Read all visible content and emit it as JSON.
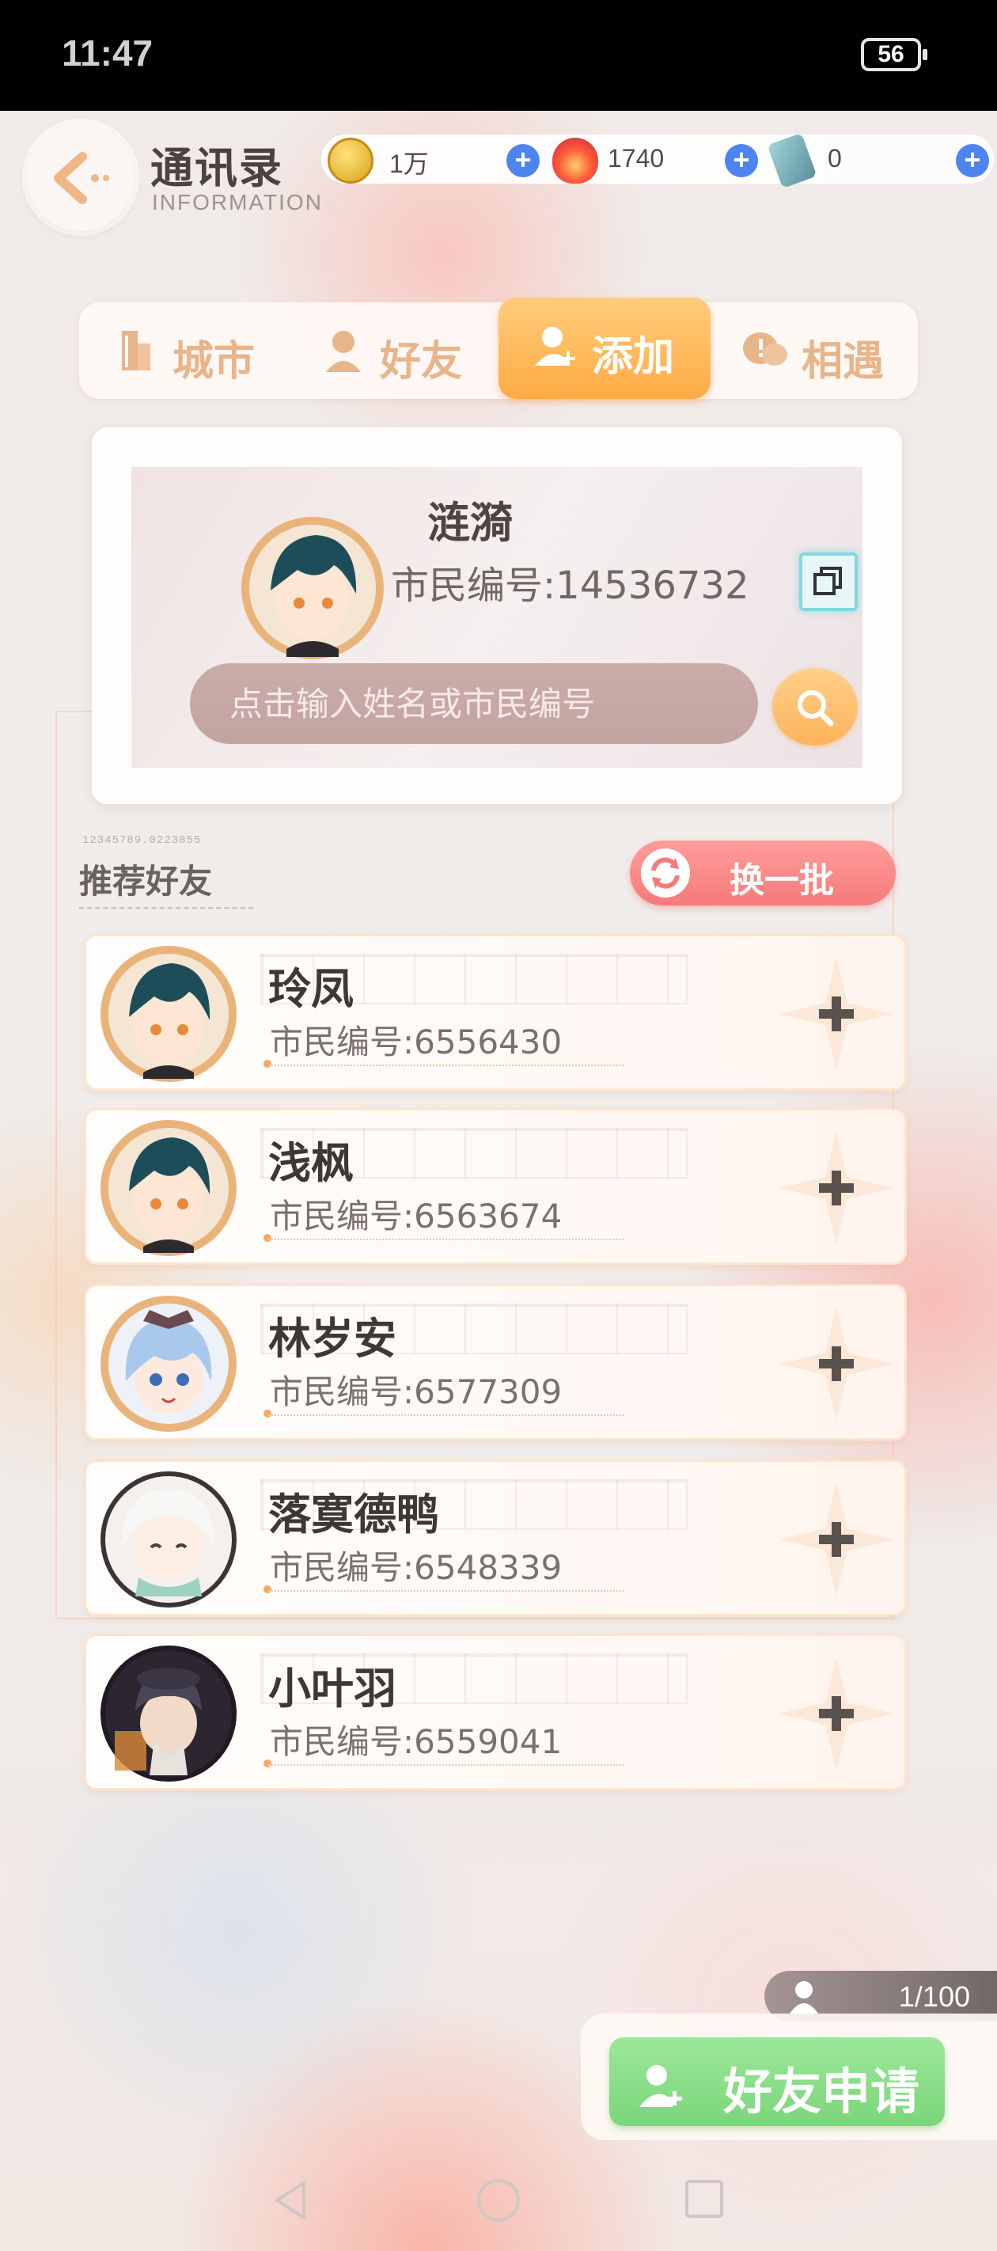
{
  "status_bar": {
    "time": "11:47",
    "battery": "56"
  },
  "header": {
    "title": "通讯录",
    "subtitle": "INFORMATION",
    "currencies": [
      {
        "icon": "gold-coin-icon",
        "value": "1万"
      },
      {
        "icon": "red-crystal-icon",
        "value": "1740"
      },
      {
        "icon": "blue-ticket-icon",
        "value": "0"
      }
    ]
  },
  "tabs": [
    {
      "label": "城市",
      "icon": "city-icon",
      "active": false
    },
    {
      "label": "好友",
      "icon": "friend-icon",
      "active": false
    },
    {
      "label": "添加",
      "icon": "add-friend-icon",
      "active": true
    },
    {
      "label": "相遇",
      "icon": "encounter-icon",
      "active": false
    }
  ],
  "me": {
    "name": "涟漪",
    "id_label": "市民编号:14536732"
  },
  "search": {
    "placeholder": "点击输入姓名或市民编号"
  },
  "recommend": {
    "code": "12345789.0223855",
    "title": "推荐好友",
    "refresh_label": "换一批",
    "friends": [
      {
        "name": "玲凤",
        "id_label": "市民编号:6556430",
        "avatar": "avatar-teal-boy"
      },
      {
        "name": "浅枫",
        "id_label": "市民编号:6563674",
        "avatar": "avatar-teal-boy"
      },
      {
        "name": "林岁安",
        "id_label": "市民编号:6577309",
        "avatar": "avatar-blue-girl"
      },
      {
        "name": "落寞德鸭",
        "id_label": "市民编号:6548339",
        "avatar": "avatar-white-hair"
      },
      {
        "name": "小叶羽",
        "id_label": "市民编号:6559041",
        "avatar": "avatar-dark-hat"
      }
    ]
  },
  "requests": {
    "count": "1/100",
    "button_label": "好友申请"
  },
  "colors": {
    "accent_orange": "#ffab45",
    "refresh_red": "#f57b7a",
    "request_green": "#7ad67a",
    "plus_blue": "#4d84f0"
  }
}
